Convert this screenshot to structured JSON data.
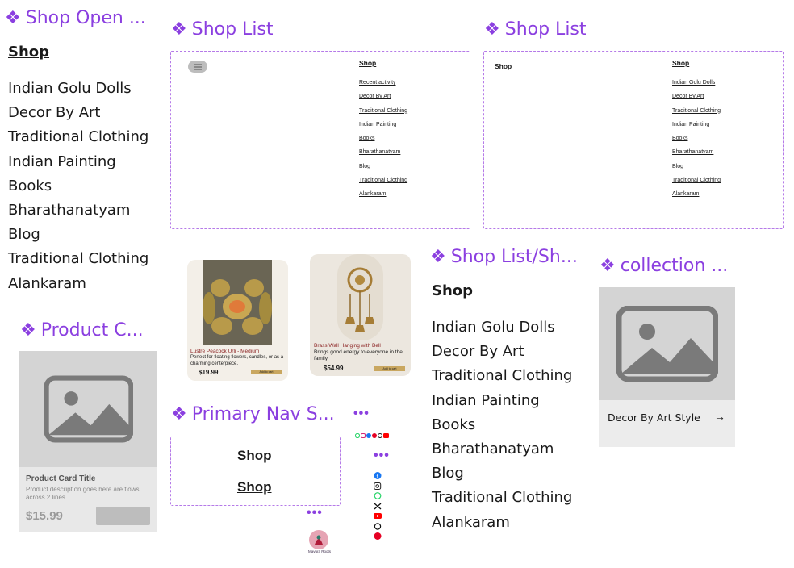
{
  "shop_open": {
    "title": "Shop Open ...",
    "heading": "Shop",
    "items": [
      "Indian Golu Dolls",
      "Decor By Art",
      "Traditional Clothing",
      "Indian Painting",
      "Books",
      "Bharathanatyam",
      "Blog",
      "Traditional Clothing",
      "Alankaram"
    ]
  },
  "shop_list_a": {
    "title": "Shop List",
    "heading": "Shop",
    "items": [
      "Recent activity",
      "Decor By Art",
      "Traditional Clothing",
      "Indian Painting",
      "Books",
      "Bharathanatyam",
      "Blog",
      "Traditional Clothing",
      "Alankaram"
    ]
  },
  "shop_list_b": {
    "title": "Shop List",
    "left_label": "Shop",
    "heading": "Shop",
    "items": [
      "Indian Golu Dolls",
      "Decor By Art",
      "Traditional Clothing",
      "Indian Painting",
      "Books",
      "Bharathanatyam",
      "Blog",
      "Traditional Clothing",
      "Alankaram"
    ]
  },
  "shop_list_sh": {
    "title": "Shop List/Sh...",
    "heading": "Shop",
    "items": [
      "Indian Golu Dolls",
      "Decor By Art",
      "Traditional Clothing",
      "Indian Painting",
      "Books",
      "Bharathanatyam",
      "Blog",
      "Traditional Clothing",
      "Alankaram"
    ]
  },
  "product_card": {
    "title": "Product C...",
    "card_title": "Product Card Title",
    "description": "Product description goes here are flows across 2 lines.",
    "price": "$15.99"
  },
  "collection": {
    "title": "collection ...",
    "label": "Decor By Art Style",
    "arrow": "→"
  },
  "products": [
    {
      "name": "Lustre Peacock Urli - Medium",
      "desc": "Perfect for floating flowers, candles, or as a charming centerpiece.",
      "price": "$19.99",
      "cta": "Add to cart"
    },
    {
      "name": "Brass Wall Hanging with Bell",
      "desc": "Brings good energy to everyone in the family.",
      "price": "$54.99",
      "cta": "Add to cart"
    }
  ],
  "primary_nav": {
    "title": "Primary Nav S...",
    "item1": "Shop",
    "item2": "Shop"
  },
  "logo": {
    "caption": "Mayura Roots"
  },
  "colors": {
    "accent": "#8b3fe0",
    "dashed": "#b57ae8",
    "placeholder": "#d4d4d4"
  }
}
